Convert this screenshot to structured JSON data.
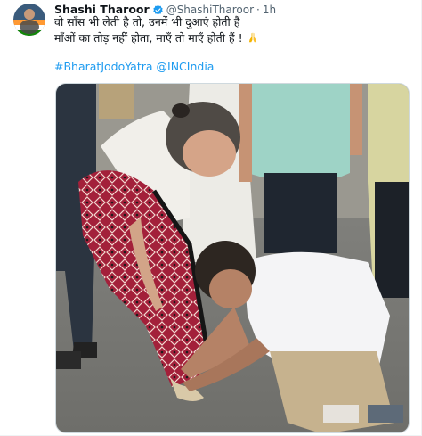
{
  "tweet": {
    "author_name": "Shashi Tharoor",
    "author_handle": "@ShashiTharoor",
    "separator": "·",
    "time": "1h",
    "text_line_1": "वो साँस भी लेती है तो, उनमें भी दुआएं होती हैं",
    "text_line_2": "माँओं का तोड़ नहीं होता, माएँ तो माएँ होती हैं !",
    "emoji_name": "folded-hands",
    "hashtag": "#BharatJodoYatra",
    "mention": "@INCIndia"
  },
  "colors": {
    "link": "#1d9bf0",
    "verified": "#1d9bf0",
    "secondary_text": "#536471"
  }
}
